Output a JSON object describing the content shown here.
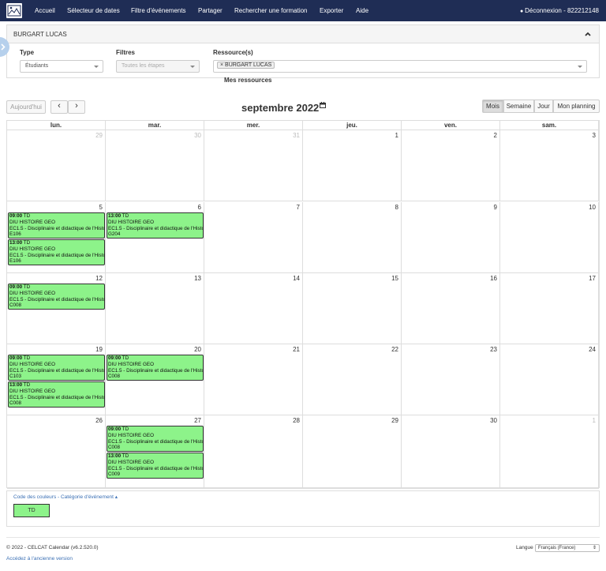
{
  "nav": {
    "items": [
      "Accueil",
      "Sélecteur de dates",
      "Filtre d'événements",
      "Partager",
      "Rechercher une formation",
      "Exporter",
      "Aide"
    ],
    "logout_label": "Déconnexion - 822212148"
  },
  "panel": {
    "title": "BURGART LUCAS",
    "type_label": "Type",
    "type_value": "Étudiants",
    "filters_label": "Filtres",
    "filters_placeholder": "Toutes les étapes",
    "resource_label": "Ressource(s)",
    "resource_tag": "× BURGART LUCAS",
    "my_resources_label": "Mes ressources"
  },
  "toolbar": {
    "today_label": "Aujourd'hui",
    "prev_label": "‹",
    "next_label": "›",
    "month_title": "septembre 2022",
    "views": [
      "Mois",
      "Semaine",
      "Jour",
      "Mon planning"
    ],
    "active_view": "Mois"
  },
  "calendar": {
    "day_headers": [
      "lun.",
      "mar.",
      "mer.",
      "jeu.",
      "ven.",
      "sam."
    ],
    "weeks": [
      [
        {
          "d": "29",
          "other": true
        },
        {
          "d": "30",
          "other": true
        },
        {
          "d": "31",
          "other": true
        },
        {
          "d": "1"
        },
        {
          "d": "2"
        },
        {
          "d": "3"
        }
      ],
      [
        {
          "d": "5"
        },
        {
          "d": "6"
        },
        {
          "d": "7"
        },
        {
          "d": "8"
        },
        {
          "d": "9"
        },
        {
          "d": "10"
        }
      ],
      [
        {
          "d": "12"
        },
        {
          "d": "13"
        },
        {
          "d": "14"
        },
        {
          "d": "15"
        },
        {
          "d": "16"
        },
        {
          "d": "17"
        }
      ],
      [
        {
          "d": "19"
        },
        {
          "d": "20"
        },
        {
          "d": "21"
        },
        {
          "d": "22"
        },
        {
          "d": "23"
        },
        {
          "d": "24"
        }
      ],
      [
        {
          "d": "26"
        },
        {
          "d": "27"
        },
        {
          "d": "28"
        },
        {
          "d": "29"
        },
        {
          "d": "30"
        },
        {
          "d": "1",
          "other": true
        }
      ]
    ],
    "events": [
      {
        "week": 1,
        "day": 0,
        "slot": 0,
        "time": "09:00",
        "kind": "TD",
        "line2": "DIU HISTOIRE GEO",
        "line3": "EC1.5 - Disciplinaire et didactique de l'Histoire",
        "room": "E106"
      },
      {
        "week": 1,
        "day": 0,
        "slot": 1,
        "time": "13:00",
        "kind": "TD",
        "line2": "DIU HISTOIRE GEO",
        "line3": "EC1.5 - Disciplinaire et didactique de l'Histoire",
        "room": "E106"
      },
      {
        "week": 1,
        "day": 1,
        "slot": 0,
        "time": "13:00",
        "kind": "TD",
        "line2": "DIU HISTOIRE GEO",
        "line3": "EC1.5 - Disciplinaire et didactique de l'Histoire",
        "room": "G204"
      },
      {
        "week": 2,
        "day": 0,
        "slot": 0,
        "time": "09:00",
        "kind": "TD",
        "line2": "DIU HISTOIRE GEO",
        "line3": "EC1.5 - Disciplinaire et didactique de l'Histoire",
        "room": "C008"
      },
      {
        "week": 3,
        "day": 0,
        "slot": 0,
        "time": "09:00",
        "kind": "TD",
        "line2": "DIU HISTOIRE GEO",
        "line3": "EC1.5 - Disciplinaire et didactique de l'Histoire",
        "room": "C103"
      },
      {
        "week": 3,
        "day": 0,
        "slot": 1,
        "time": "13:00",
        "kind": "TD",
        "line2": "DIU HISTOIRE GEO",
        "line3": "EC1.5 - Disciplinaire et didactique de l'Histoire",
        "room": "C008"
      },
      {
        "week": 3,
        "day": 1,
        "slot": 0,
        "time": "09:00",
        "kind": "TD",
        "line2": "DIU HISTOIRE GEO",
        "line3": "EC1.5 - Disciplinaire et didactique de l'Histoire",
        "room": "C008"
      },
      {
        "week": 4,
        "day": 1,
        "slot": 0,
        "time": "09:00",
        "kind": "TD",
        "line2": "DIU HISTOIRE GEO",
        "line3": "EC1.5 - Disciplinaire et didactique de l'Histoire",
        "room": "C008"
      },
      {
        "week": 4,
        "day": 1,
        "slot": 1,
        "time": "13:00",
        "kind": "TD",
        "line2": "DIU HISTOIRE GEO",
        "line3": "EC1.5 - Disciplinaire et didactique de l'Histoire",
        "room": "C009"
      }
    ]
  },
  "legend": {
    "title": "Code des couleurs - Catégorie d'événement ▴",
    "item_label": "TD"
  },
  "footer": {
    "copyright": "© 2022 - CELCAT Calendar (v6.2.520.0)",
    "old_version_link": "Accédez à l'ancienne version",
    "language_label": "Langue",
    "language_value": "Français (France)"
  },
  "colors": {
    "nav_bg": "#1f2d55",
    "event_green": "#8df38a",
    "link_blue": "#3a6fb4"
  }
}
